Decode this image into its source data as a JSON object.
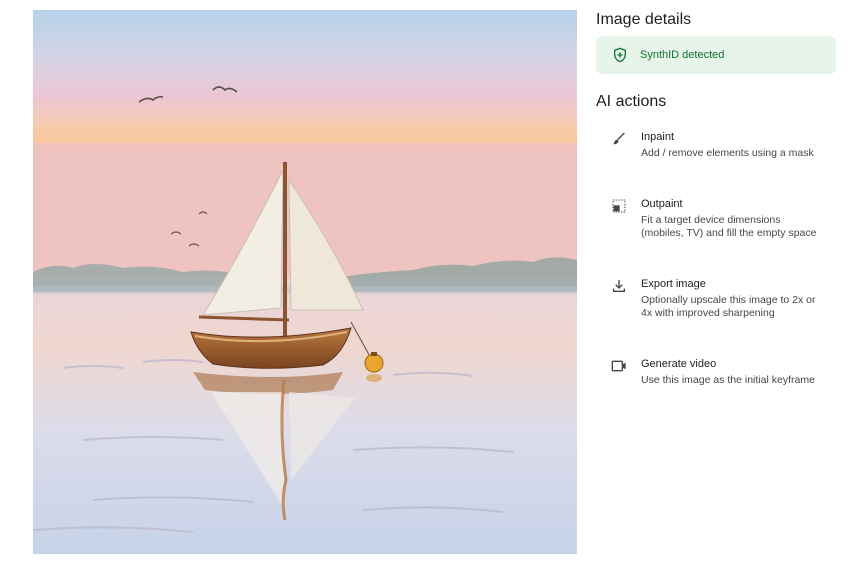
{
  "image": {
    "subject": "Watercolor painting of a sailboat with a buoy on calm water at sunset",
    "colors": {
      "sky_top": "#b9d4ea",
      "sky_mid": "#e9c3d3",
      "sky_glow": "#f5c59a",
      "water": "#d8dcea",
      "hull": "#9a5b2d",
      "sail": "#f4efe6",
      "buoy": "#e6a230"
    }
  },
  "details": {
    "title": "Image details",
    "synthid": {
      "label": "SynthID detected",
      "icon": "shield-icon",
      "bg_color": "#e6f4ea",
      "text_color": "#137333"
    }
  },
  "actions": {
    "title": "AI actions",
    "items": [
      {
        "icon": "brush-icon",
        "title": "Inpaint",
        "description": "Add / remove elements using a mask"
      },
      {
        "icon": "outpaint-icon",
        "title": "Outpaint",
        "description": "Fit a target device dimensions (mobiles, TV) and fill the empty space"
      },
      {
        "icon": "download-icon",
        "title": "Export image",
        "description": "Optionally upscale this image to 2x or 4x with improved sharpening"
      },
      {
        "icon": "video-icon",
        "title": "Generate video",
        "description": "Use this image as the initial keyframe"
      }
    ]
  }
}
